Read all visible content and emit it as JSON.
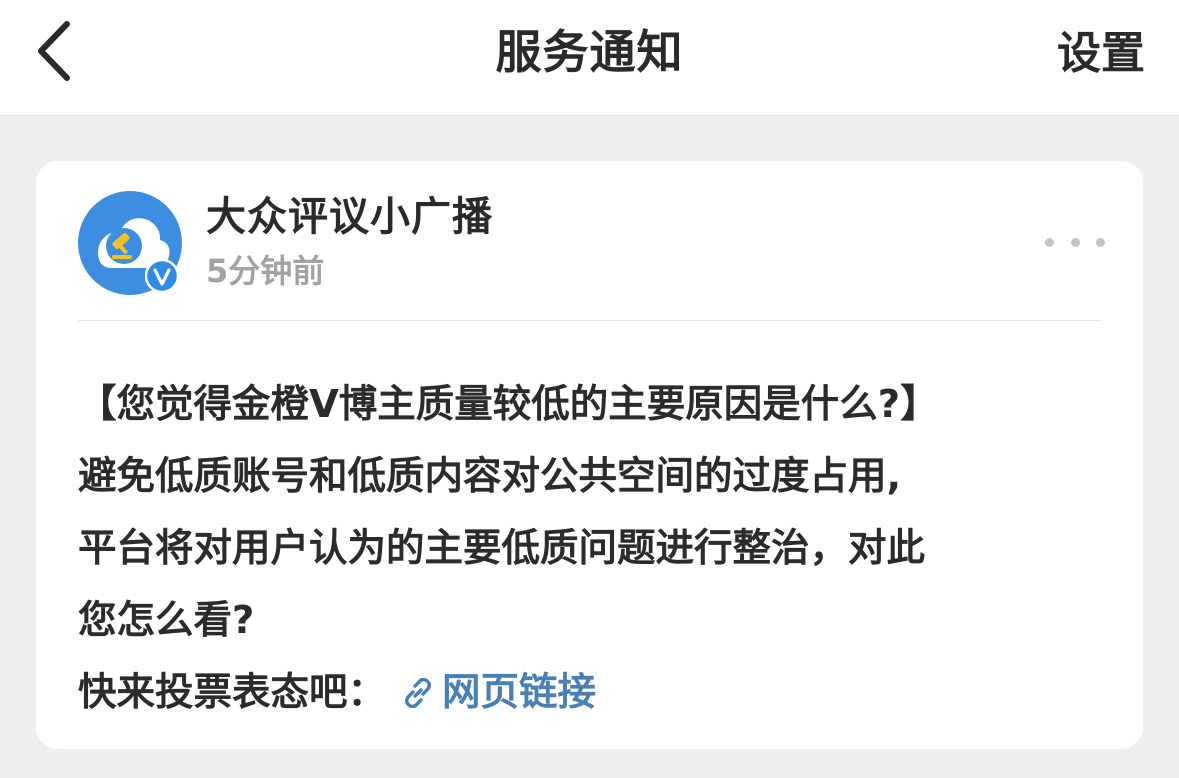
{
  "header": {
    "title": "服务通知",
    "settings_label": "设置",
    "back_icon": "chevron-left-icon"
  },
  "notification": {
    "sender_name": "大众评议小广播",
    "time": "5分钟前",
    "avatar_icon": "gavel-cloud-avatar-icon",
    "verified_badge_label": "V",
    "message_lines": [
      "【您觉得金橙Ⅴ博主质量较低的主要原因是什么?】",
      "避免低质账号和低质内容对公共空间的过度占用,",
      "平台将对用户认为的主要低质问题进行整治，对此",
      "您怎么看?"
    ],
    "cta_text": "快来投票表态吧：",
    "link_label": "网页链接",
    "link_icon": "link-icon"
  },
  "colors": {
    "page_background": "#efefef",
    "card_background": "#ffffff",
    "avatar_blue": "#3d8de0",
    "badge_blue": "#2d8be6",
    "link_blue": "#4a7fb4",
    "timestamp_gray": "#a2a2a2"
  }
}
